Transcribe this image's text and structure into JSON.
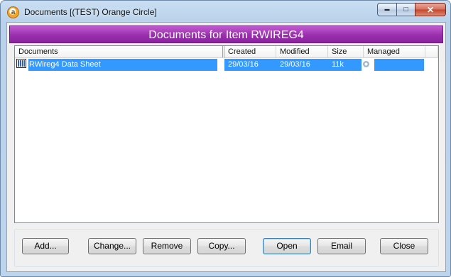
{
  "window": {
    "title": "Documents [(TEST) Orange Circle]",
    "app_icon_glyph": "a",
    "controls": {
      "minimize": "▬",
      "maximize": "□",
      "close": "✕"
    }
  },
  "header": {
    "title": "Documents for Item RWIREG4"
  },
  "table": {
    "columns": [
      "Documents",
      "Created",
      "Modified",
      "Size",
      "Managed"
    ],
    "rows": [
      {
        "name": "RWireg4 Data Sheet",
        "created": "29/03/16",
        "modified": "29/03/16",
        "size": "11k",
        "managed_icon": "managed-status-icon",
        "selected": true
      }
    ]
  },
  "buttons": {
    "add": "Add...",
    "change": "Change...",
    "remove": "Remove",
    "copy": "Copy...",
    "open": "Open",
    "email": "Email",
    "close": "Close"
  },
  "colors": {
    "banner": "#9a2fae",
    "selection": "#3399ff"
  }
}
